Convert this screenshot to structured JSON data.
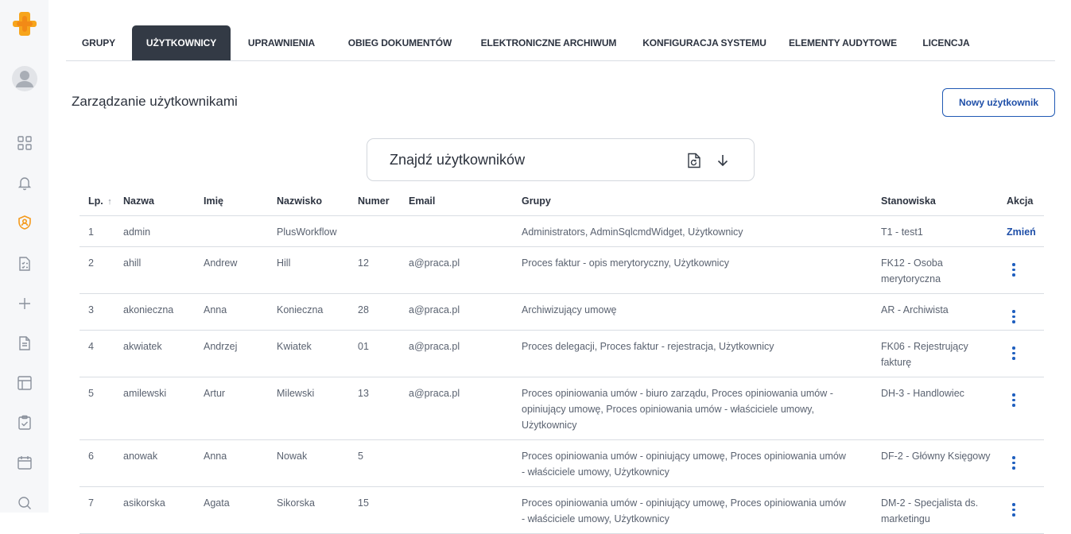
{
  "sidebar": {
    "icons": [
      "logo-plus-icon",
      "avatar",
      "dashboard-grid-icon",
      "bell-icon",
      "shield-user-icon",
      "checklist-document-icon",
      "plus-icon",
      "document-icon",
      "layout-icon",
      "clipboard-check-icon",
      "calendar-icon",
      "search-icon"
    ],
    "accent_color": "#f59a1b"
  },
  "tabs": [
    {
      "label": "GRUPY",
      "active": false
    },
    {
      "label": "UŻYTKOWNICY",
      "active": true
    },
    {
      "label": "UPRAWNIENIA",
      "active": false
    },
    {
      "label": "OBIEG DOKUMENTÓW",
      "active": false
    },
    {
      "label": "ELEKTRONICZNE ARCHIWUM",
      "active": false
    },
    {
      "label": "KONFIGURACJA SYSTEMU",
      "active": false
    },
    {
      "label": "ELEMENTY AUDYTOWE",
      "active": false
    },
    {
      "label": "LICENCJA",
      "active": false
    }
  ],
  "page": {
    "title": "Zarządzanie użytkownikami",
    "new_user_label": "Nowy użytkownik"
  },
  "search": {
    "label": "Znajdź użytkowników"
  },
  "table": {
    "headers": {
      "lp": "Lp.",
      "lp_sort": "↑",
      "nazwa": "Nazwa",
      "imie": "Imię",
      "nazwisko": "Nazwisko",
      "numer": "Numer",
      "email": "Email",
      "grupy": "Grupy",
      "stanowiska": "Stanowiska",
      "akcja": "Akcja"
    },
    "rows": [
      {
        "lp": "1",
        "nazwa": "admin",
        "imie": "",
        "nazwisko": "PlusWorkflow",
        "numer": "",
        "email": "",
        "grupy": "Administrators, AdminSqlcmdWidget, Użytkownicy",
        "stanowiska": "T1 - test1",
        "akcja": "Zmień"
      },
      {
        "lp": "2",
        "nazwa": "ahill",
        "imie": "Andrew",
        "nazwisko": "Hill",
        "numer": "12",
        "email": "a@praca.pl",
        "grupy": "Proces faktur - opis merytoryczny, Użytkownicy",
        "stanowiska": "FK12 - Osoba merytoryczna",
        "akcja": ""
      },
      {
        "lp": "3",
        "nazwa": "akonieczna",
        "imie": "Anna",
        "nazwisko": "Konieczna",
        "numer": "28",
        "email": "a@praca.pl",
        "grupy": "Archiwizujący umowę",
        "stanowiska": "AR - Archiwista",
        "akcja": ""
      },
      {
        "lp": "4",
        "nazwa": "akwiatek",
        "imie": "Andrzej",
        "nazwisko": "Kwiatek",
        "numer": "01",
        "email": "a@praca.pl",
        "grupy": "Proces delegacji, Proces faktur - rejestracja, Użytkownicy",
        "stanowiska": "FK06 - Rejestrujący fakturę",
        "akcja": ""
      },
      {
        "lp": "5",
        "nazwa": "amilewski",
        "imie": "Artur",
        "nazwisko": "Milewski",
        "numer": "13",
        "email": "a@praca.pl",
        "grupy": "Proces opiniowania umów - biuro zarządu, Proces opiniowania umów - opiniujący umowę, Proces opiniowania umów - właściciele umowy, Użytkownicy",
        "stanowiska": "DH-3 - Handlowiec",
        "akcja": ""
      },
      {
        "lp": "6",
        "nazwa": "anowak",
        "imie": "Anna",
        "nazwisko": "Nowak",
        "numer": "5",
        "email": "",
        "grupy": "Proces opiniowania umów - opiniujący umowę, Proces opiniowania umów - właściciele umowy, Użytkownicy",
        "stanowiska": "DF-2 - Główny Księgowy",
        "akcja": ""
      },
      {
        "lp": "7",
        "nazwa": "asikorska",
        "imie": "Agata",
        "nazwisko": "Sikorska",
        "numer": "15",
        "email": "",
        "grupy": "Proces opiniowania umów - opiniujący umowę, Proces opiniowania umów - właściciele umowy, Użytkownicy",
        "stanowiska": "DM-2 - Specjalista ds. marketingu",
        "akcja": ""
      }
    ]
  }
}
